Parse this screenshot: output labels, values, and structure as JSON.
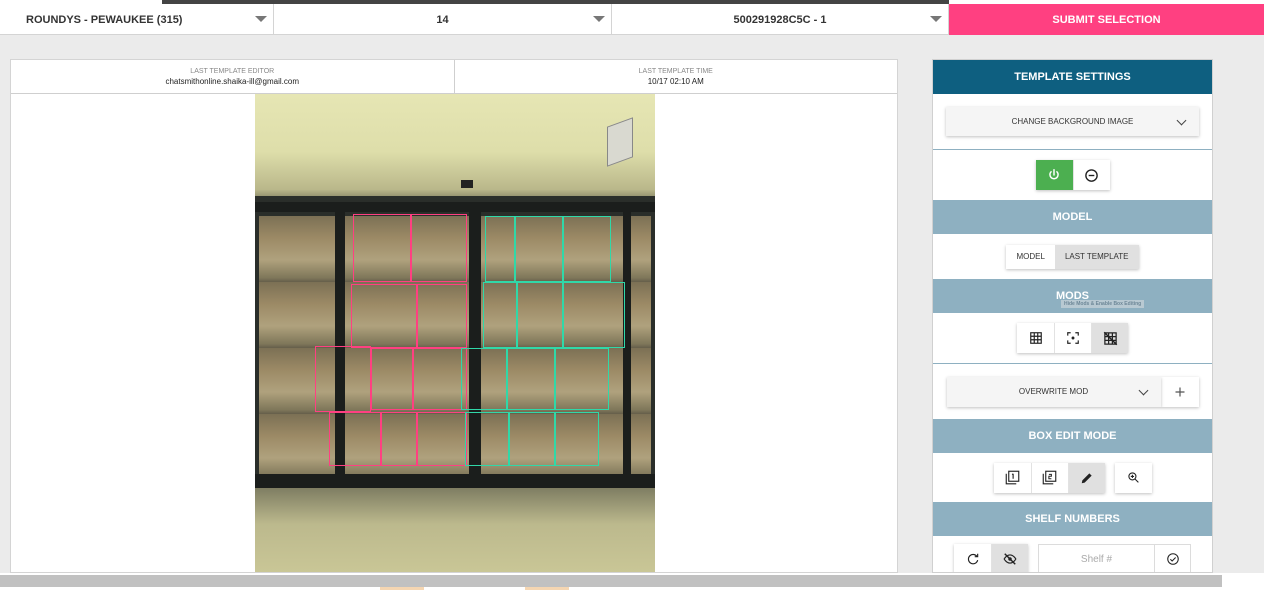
{
  "topbar": {
    "store": "ROUNDYS - PEWAUKEE (315)",
    "number": "14",
    "device": "500291928C5C - 1",
    "submit_label": "SUBMIT SELECTION"
  },
  "template_info": {
    "editor_label": "LAST TEMPLATE EDITOR",
    "editor_value": "chatsmithonline.shaika-ill@gmail.com",
    "time_label": "LAST TEMPLATE TIME",
    "time_value": "10/17 02:10 AM"
  },
  "settings": {
    "header": "TEMPLATE SETTINGS",
    "background_dropdown": "CHANGE BACKGROUND IMAGE",
    "model_section": "MODEL",
    "model_options": [
      "MODEL",
      "LAST TEMPLATE"
    ],
    "model_selected": "LAST TEMPLATE",
    "mods_section": "MODS",
    "mods_tooltip": "Hide Mods & Enable Box Editing",
    "mod_dropdown": "OVERWRITE MOD",
    "box_edit_section": "BOX EDIT MODE",
    "shelf_section": "SHELF NUMBERS",
    "shelf_placeholder": "Shelf #"
  },
  "icons": {
    "power": "power-icon",
    "minus_circle": "minus-circle-icon",
    "grid": "grid-icon",
    "focus": "center-focus-icon",
    "grid_off": "grid-off-icon",
    "box_one": "filter-1-icon",
    "box_two": "filter-2-icon",
    "edit": "pencil-icon",
    "zoom": "zoom-in-icon",
    "refresh": "refresh-icon",
    "hide": "eye-off-icon",
    "confirm": "check-circle-icon",
    "add": "plus-icon"
  },
  "colors": {
    "accent": "#ff4081",
    "header": "#0e5f80",
    "section": "#8eb0c1",
    "toggle_on": "#4caf50",
    "box_pink": "#ff4081",
    "box_teal": "#30d8a8"
  }
}
